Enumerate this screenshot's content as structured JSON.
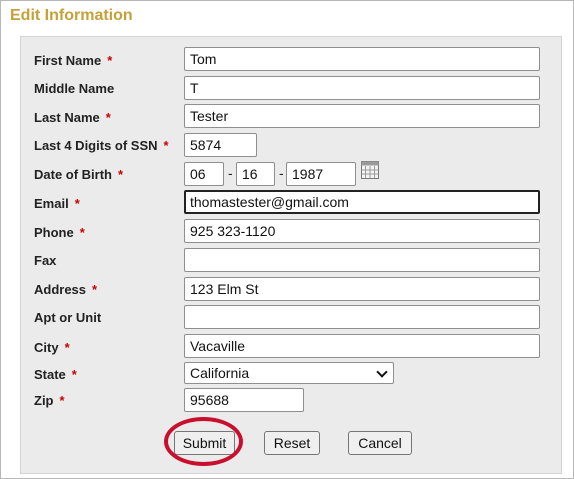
{
  "page": {
    "title": "Edit Information"
  },
  "form": {
    "required_marker": "*",
    "first_name": {
      "label": "First Name",
      "value": "Tom"
    },
    "middle_name": {
      "label": "Middle Name",
      "value": "T"
    },
    "last_name": {
      "label": "Last Name",
      "value": "Tester"
    },
    "ssn_last4": {
      "label": "Last 4 Digits of SSN",
      "value": "5874"
    },
    "dob": {
      "label": "Date of Birth",
      "month": "06",
      "day": "16",
      "year": "1987",
      "separator": "-",
      "icon": "calendar-icon"
    },
    "email": {
      "label": "Email",
      "value": "thomastester@gmail.com"
    },
    "phone": {
      "label": "Phone",
      "value": "925 323-1120"
    },
    "fax": {
      "label": "Fax",
      "value": ""
    },
    "address": {
      "label": "Address",
      "value": "123 Elm St"
    },
    "apt": {
      "label": "Apt or Unit",
      "value": ""
    },
    "city": {
      "label": "City",
      "value": "Vacaville"
    },
    "state": {
      "label": "State",
      "value": "California"
    },
    "zip": {
      "label": "Zip",
      "value": "95688"
    }
  },
  "buttons": {
    "submit": "Submit",
    "reset": "Reset",
    "cancel": "Cancel"
  },
  "annotation": {
    "highlight_color": "#c8102e",
    "highlighted": "submit-button"
  }
}
